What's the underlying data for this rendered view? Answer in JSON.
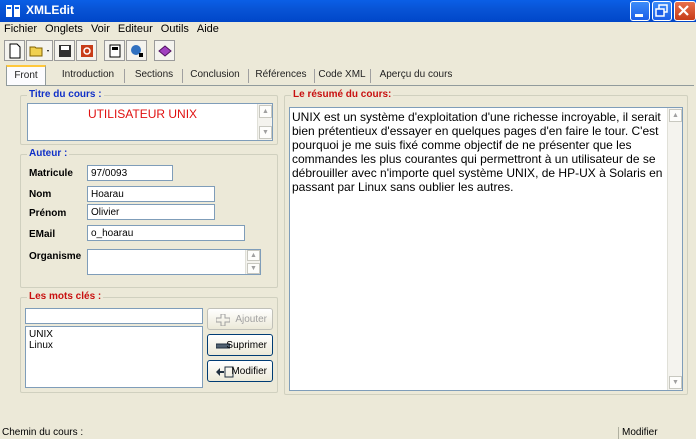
{
  "window": {
    "title": "XMLEdit"
  },
  "menu": [
    "Fichier",
    "Onglets",
    "Voir",
    "Editeur",
    "Outils",
    "Aide"
  ],
  "toolbar": {
    "buttons": [
      "new-file-icon",
      "open-folder-icon",
      "save-icon",
      "close-icon",
      "properties-icon",
      "preview-icon",
      "book-icon"
    ]
  },
  "tabs": [
    "Front",
    "Introduction",
    "Sections",
    "Conclusion",
    "Références",
    "Code XML",
    "Aperçu du cours"
  ],
  "titre": {
    "label": "Titre du cours :",
    "value": "UTILISATEUR UNIX"
  },
  "auteur": {
    "label": "Auteur :",
    "matricule": {
      "label": "Matricule",
      "value": "97/0093"
    },
    "nom": {
      "label": "Nom",
      "value": "Hoarau"
    },
    "prenom": {
      "label": "Prénom",
      "value": "Olivier"
    },
    "email": {
      "label": "EMail",
      "value": "o_hoarau"
    },
    "organisme": {
      "label": "Organisme",
      "value": ""
    }
  },
  "mots_cles": {
    "label": "Les mots clés :",
    "input_value": "",
    "items": [
      "UNIX",
      "Linux"
    ],
    "buttons": {
      "ajouter": "Ajouter",
      "supprimer": "Suprimer",
      "modifier": "Modifier"
    }
  },
  "resume": {
    "label": "Le résumé du cours:",
    "text": "UNIX est un système d'exploitation d'une richesse incroyable, il serait bien prétentieux d'essayer en quelques pages d'en faire le tour. C'est pourquoi je me suis fixé comme objectif de ne présenter que les commandes les plus courantes qui permettront à un utilisateur de se débrouiller avec n'importe quel système UNIX, de HP-UX à Solaris en passant par Linux sans oublier les autres."
  },
  "status": {
    "left": "Chemin du cours :",
    "right": "Modifier"
  }
}
